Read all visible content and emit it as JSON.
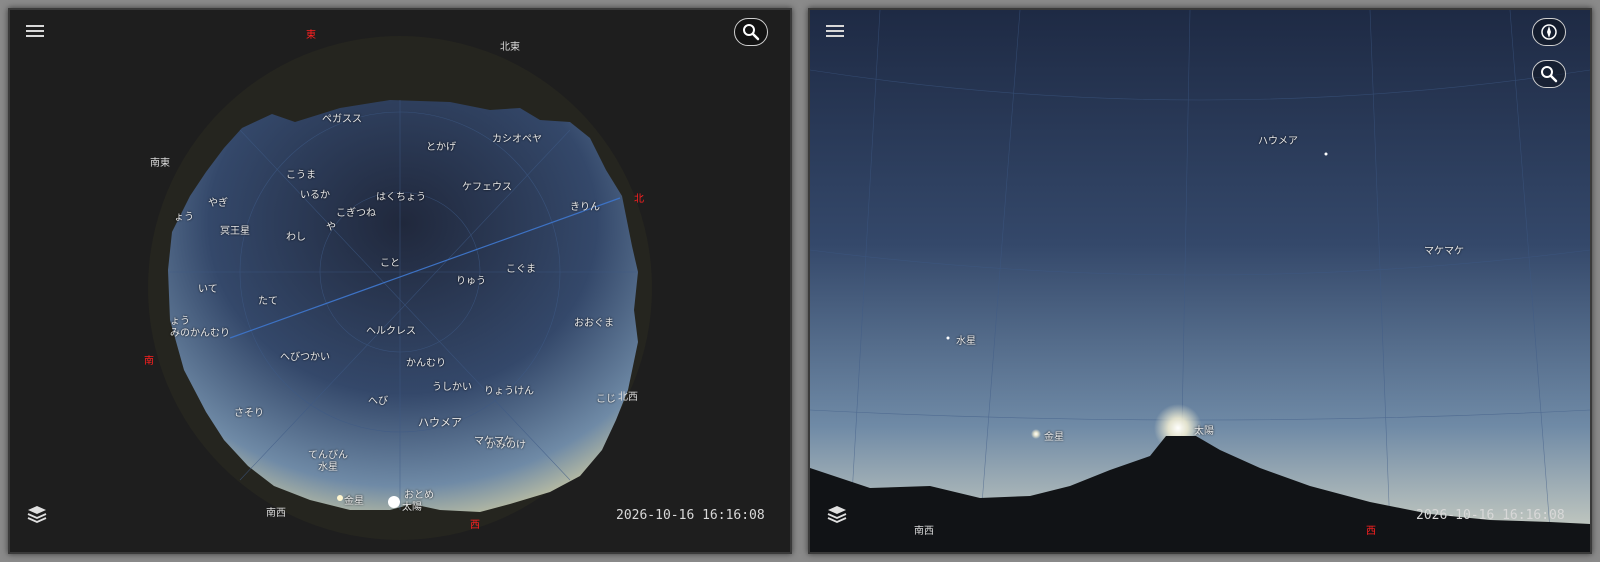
{
  "left_view": {
    "directions": {
      "east": "東",
      "north": "北",
      "south": "南",
      "west": "西",
      "northeast": "北東",
      "southeast": "南東",
      "northwest": "北西",
      "southwest": "南西"
    },
    "constellations": [
      "ペガスス",
      "とかげ",
      "カシオペヤ",
      "こうま",
      "いるか",
      "はくちょう",
      "ケフェウス",
      "きりん",
      "やぎ",
      "こぎつね",
      "や",
      "わし",
      "こと",
      "りゅう",
      "こぐま",
      "いて",
      "たて",
      "ヘルクレス",
      "おおぐま",
      "へびつかい",
      "かんむり",
      "うしかい",
      "りょうけん",
      "へび",
      "さそり",
      "てんびん",
      "おとめ",
      "ょう",
      "ょう",
      "みのかんむり",
      "こじ",
      "かみのけ"
    ],
    "objects": [
      "冥王星",
      "ハウメア",
      "マケマケ",
      "水星",
      "金星",
      "太陽"
    ],
    "datetime": "2026-10-16 16:16:08"
  },
  "right_view": {
    "directions": {
      "southwest": "南西",
      "west": "西"
    },
    "objects": [
      "ハウメア",
      "マケマケ",
      "水星",
      "金星",
      "太陽"
    ],
    "datetime": "2026-10-16 16:16:08"
  },
  "icons": {
    "menu": "menu-icon",
    "search": "search-icon",
    "compass": "compass-icon",
    "layers": "layers-icon"
  },
  "colors": {
    "direction_cardinal": "#ff2020",
    "direction_intercardinal": "#d8d8d8",
    "sky_top": "#1e2a44",
    "sky_horizon": "#6f8aa6"
  }
}
